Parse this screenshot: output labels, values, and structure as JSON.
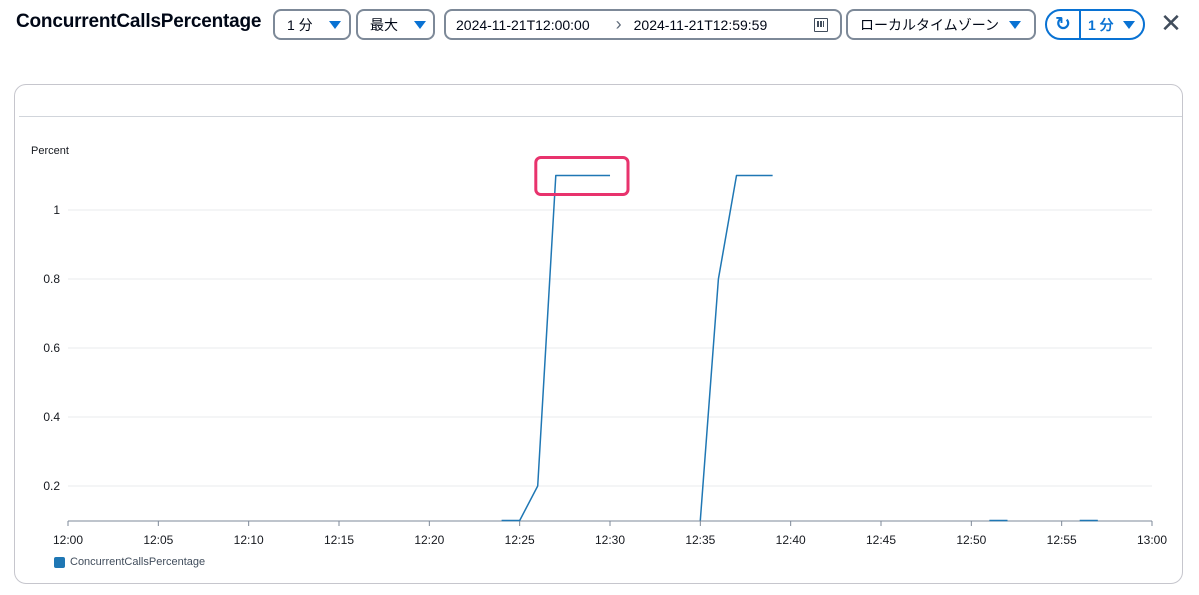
{
  "header": {
    "title": "ConcurrentCallsPercentage",
    "period": "1 分",
    "statistic": "最大",
    "range_start": "2024-11-21T12:00:00",
    "range_end": "2024-11-21T12:59:59",
    "timezone": "ローカルタイムゾーン",
    "refresh_interval": "1 分",
    "icons": {
      "dropdown": "caret-down-icon",
      "range_separator": "chevron-right-icon",
      "calendar": "calendar-icon",
      "refresh": "refresh-icon",
      "close": "close-icon"
    }
  },
  "colors": {
    "accent": "#0972d3",
    "series": "#1f77b4",
    "highlight": "#e8336d"
  },
  "chart_data": {
    "type": "line",
    "title": "",
    "ylabel": "Percent",
    "xlabel": "",
    "xlim": [
      "12:00",
      "13:00"
    ],
    "ylim": [
      0.1,
      1.1
    ],
    "x_ticks": [
      "12:00",
      "12:05",
      "12:10",
      "12:15",
      "12:20",
      "12:25",
      "12:30",
      "12:35",
      "12:40",
      "12:45",
      "12:50",
      "12:55",
      "13:00"
    ],
    "y_ticks": [
      "0.2",
      "0.4",
      "0.6",
      "0.8",
      "1"
    ],
    "grid": true,
    "legend_position": "bottom-left",
    "series": [
      {
        "name": "ConcurrentCallsPercentage",
        "segments": [
          [
            [
              "12:24",
              0.1
            ],
            [
              "12:25",
              0.1
            ],
            [
              "12:26",
              0.2
            ],
            [
              "12:27",
              1.1
            ],
            [
              "12:28",
              1.1
            ],
            [
              "12:29",
              1.1
            ],
            [
              "12:30",
              1.1
            ]
          ],
          [
            [
              "12:35",
              0.1
            ],
            [
              "12:36",
              0.8
            ],
            [
              "12:37",
              1.1
            ],
            [
              "12:38",
              1.1
            ],
            [
              "12:39",
              1.1
            ]
          ],
          [
            [
              "12:51",
              0.1
            ],
            [
              "12:52",
              0.1
            ]
          ],
          [
            [
              "12:56",
              0.1
            ],
            [
              "12:57",
              0.1
            ]
          ]
        ]
      }
    ]
  }
}
